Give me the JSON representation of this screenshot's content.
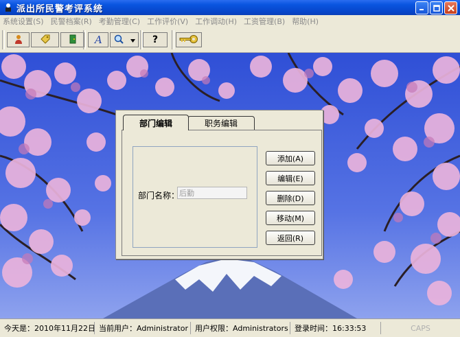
{
  "window": {
    "title": "派出所民警考评系统"
  },
  "menu": [
    "系统设置(S)",
    "民警档案(R)",
    "考勤管理(C)",
    "工作评价(V)",
    "工作调动(H)",
    "工资管理(B)",
    "帮助(H)"
  ],
  "toolbar": {
    "icons": [
      "user-icon",
      "tag-icon",
      "exit-door-icon",
      "font-icon",
      "search-icon",
      "dropdown-arrow-icon",
      "help-icon",
      "key-icon"
    ],
    "help_glyph": "?"
  },
  "dialog": {
    "tabs": [
      "部门编辑",
      "职务编辑"
    ],
    "active_tab": 0,
    "field_label": "部门名称：",
    "field_value": "后勤",
    "buttons": [
      "添加(A)",
      "编辑(E)",
      "删除(D)",
      "移动(M)",
      "返回(R)"
    ]
  },
  "status": {
    "date": "今天是：2010年11月22日",
    "user": "当前用户：Administrator",
    "role": "用户权限：Administrators",
    "login_time": "登录时间：16:33:53",
    "caps": "CAPS"
  }
}
